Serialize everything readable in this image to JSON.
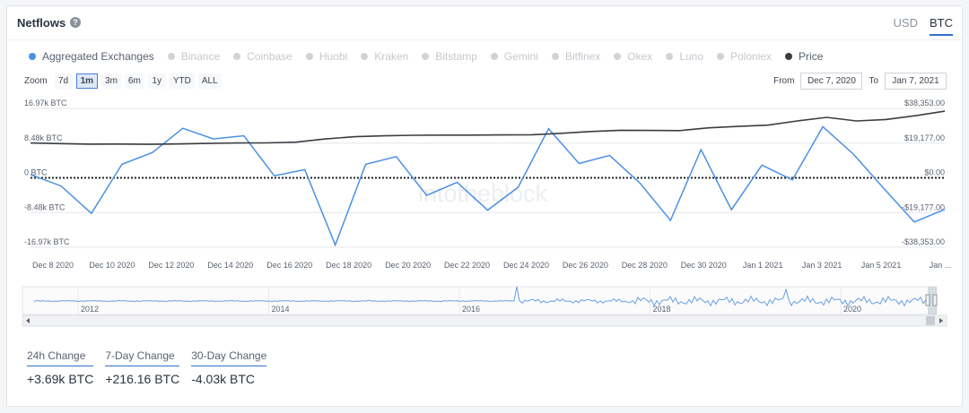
{
  "header": {
    "title": "Netflows",
    "help_icon": "?"
  },
  "unit_tabs": [
    {
      "label": "USD",
      "active": false
    },
    {
      "label": "BTC",
      "active": true
    }
  ],
  "legend": [
    {
      "label": "Aggregated Exchanges",
      "color": "#4a90e2",
      "on": true
    },
    {
      "label": "Binance",
      "color": "#cfd3d8",
      "on": false
    },
    {
      "label": "Coinbase",
      "color": "#cfd3d8",
      "on": false
    },
    {
      "label": "Huobi",
      "color": "#cfd3d8",
      "on": false
    },
    {
      "label": "Kraken",
      "color": "#cfd3d8",
      "on": false
    },
    {
      "label": "Bitstamp",
      "color": "#cfd3d8",
      "on": false
    },
    {
      "label": "Gemini",
      "color": "#cfd3d8",
      "on": false
    },
    {
      "label": "Bitfinex",
      "color": "#cfd3d8",
      "on": false
    },
    {
      "label": "Okex",
      "color": "#cfd3d8",
      "on": false
    },
    {
      "label": "Luno",
      "color": "#cfd3d8",
      "on": false
    },
    {
      "label": "Poloniex",
      "color": "#cfd3d8",
      "on": false
    },
    {
      "label": "Price",
      "color": "#3a3d42",
      "on": true
    }
  ],
  "zoom": {
    "label": "Zoom",
    "buttons": [
      "7d",
      "1m",
      "3m",
      "6m",
      "1y",
      "YTD",
      "ALL"
    ],
    "active": "1m"
  },
  "range": {
    "from_label": "From",
    "from_value": "Dec 7, 2020",
    "to_label": "To",
    "to_value": "Jan 7, 2021"
  },
  "stats": [
    {
      "label": "24h Change",
      "value": "+3.69k BTC"
    },
    {
      "label": "7-Day Change",
      "value": "+216.16 BTC"
    },
    {
      "label": "30-Day Change",
      "value": "-4.03k BTC"
    }
  ],
  "watermark": "intotheblock",
  "chart_data": {
    "type": "line",
    "colors": {
      "netflow": "#4a90e2",
      "price": "#3a3d42",
      "navigator": "#6a9fe0"
    },
    "left_axis": {
      "ticks": [
        "16.97k BTC",
        "8.48k BTC",
        "0 BTC",
        "-8.48k BTC",
        "-16.97k BTC"
      ],
      "ylim": [
        -16970,
        16970
      ]
    },
    "right_axis": {
      "ticks": [
        "$38,353.00",
        "$19,177.00",
        "$0.00",
        "-$19,177.00",
        "-$38,353.00"
      ],
      "ylim": [
        -38353,
        38353
      ]
    },
    "x_ticks": [
      "Dec 8 2020",
      "Dec 10 2020",
      "Dec 12 2020",
      "Dec 14 2020",
      "Dec 16 2020",
      "Dec 18 2020",
      "Dec 20 2020",
      "Dec 22 2020",
      "Dec 24 2020",
      "Dec 26 2020",
      "Dec 28 2020",
      "Dec 30 2020",
      "Jan 1 2021",
      "Jan 3 2021",
      "Jan 5 2021",
      "Jan ..."
    ],
    "series": [
      {
        "name": "Aggregated Exchanges",
        "axis": "left",
        "values": [
          800,
          -2000,
          -8700,
          3300,
          6200,
          12100,
          9500,
          10300,
          500,
          2000,
          -16400,
          3300,
          5200,
          -4300,
          -1100,
          -7900,
          -2300,
          12000,
          3500,
          5500,
          -1300,
          -10400,
          6900,
          -7800,
          3100,
          -500,
          12500,
          5800,
          -2600,
          -10800,
          -7700
        ]
      },
      {
        "name": "Price",
        "axis": "right",
        "values": [
          19250,
          18900,
          18600,
          18650,
          18500,
          18700,
          19000,
          19250,
          19300,
          19700,
          21500,
          22700,
          23200,
          23500,
          23600,
          23600,
          23700,
          23800,
          24600,
          25600,
          26300,
          26200,
          26100,
          27600,
          28400,
          29100,
          31400,
          33400,
          31400,
          32200,
          34300,
          36800
        ]
      }
    ],
    "navigator": {
      "x_ticks": [
        "2012",
        "2014",
        "2016",
        "2018",
        "2020"
      ]
    }
  }
}
